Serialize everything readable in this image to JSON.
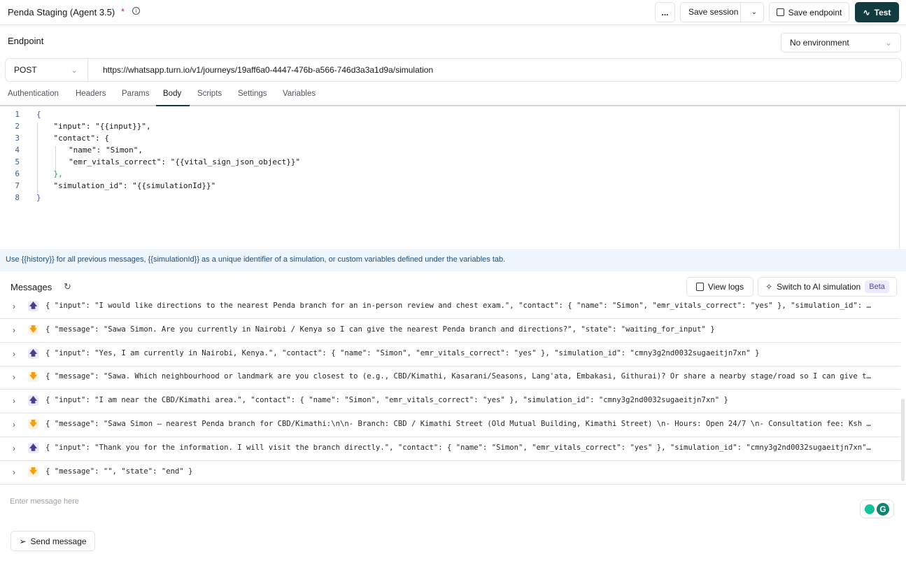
{
  "header": {
    "title": "Penda Staging (Agent 3.5)",
    "unsaved_marker": "*",
    "more_label": "...",
    "save_session": "Save session",
    "save_endpoint": "Save endpoint",
    "test": "Test"
  },
  "endpoint": {
    "label": "Endpoint",
    "environment": "No environment",
    "method": "POST",
    "url": "https://whatsapp.turn.io/v1/journeys/19aff6a0-4447-476b-a566-746d3a3a1d9a/simulation"
  },
  "tabs": [
    {
      "label": "Authentication"
    },
    {
      "label": "Headers"
    },
    {
      "label": "Params"
    },
    {
      "label": "Body",
      "active": true
    },
    {
      "label": "Scripts"
    },
    {
      "label": "Settings"
    },
    {
      "label": "Variables"
    }
  ],
  "body_code": [
    "{",
    "    \"input\": \"{{input}}\",",
    "    \"contact\": {",
    "        \"name\": \"Simon\",",
    "        \"emr_vitals_correct\": \"{{vital_sign_json_object}}\"",
    "    },",
    "    \"simulation_id\": \"{{simulationId}}\"",
    "}"
  ],
  "hint": "Use {{history}} for all previous messages, {{simulationId}} as a unique identifier of a simulation, or custom variables defined under the variables tab.",
  "messages": {
    "title": "Messages",
    "view_logs": "View logs",
    "switch_ai": "Switch to AI simulation",
    "beta": "Beta",
    "items": [
      {
        "direction": "up",
        "text": "{ \"input\": \"I would like directions to the nearest Penda branch for an in-person review and chest exam.\", \"contact\": { \"name\": \"Simon\", \"emr_vitals_correct\": \"yes\" }, \"simulation_id\": …"
      },
      {
        "direction": "down",
        "text": "{ \"message\": \"Sawa Simon. Are you currently in Nairobi / Kenya so I can give the nearest Penda branch and directions?\", \"state\": \"waiting_for_input\" }"
      },
      {
        "direction": "up",
        "text": "{ \"input\": \"Yes, I am currently in Nairobi, Kenya.\", \"contact\": { \"name\": \"Simon\", \"emr_vitals_correct\": \"yes\" }, \"simulation_id\": \"cmny3g2nd0032sugaeitjn7xn\" }"
      },
      {
        "direction": "down",
        "text": "{ \"message\": \"Sawa. Which neighbourhood or landmark are you closest to (e.g., CBD/Kimathi, Kasarani/Seasons, Lang'ata, Embakasi, Githurai)? Or share a nearby stage/road so I can give t…"
      },
      {
        "direction": "up",
        "text": "{ \"input\": \"I am near the CBD/Kimathi area.\", \"contact\": { \"name\": \"Simon\", \"emr_vitals_correct\": \"yes\" }, \"simulation_id\": \"cmny3g2nd0032sugaeitjn7xn\" }"
      },
      {
        "direction": "down",
        "text": "{ \"message\": \"Sawa Simon — nearest Penda branch for CBD/Kimathi:\\n\\n- Branch: CBD / Kimathi Street (Old Mutual Building, Kimathi Street) \\n- Hours: Open 24/7 \\n- Consultation fee: Ksh …"
      },
      {
        "direction": "up",
        "text": "{ \"input\": \"Thank you for the information. I will visit the branch directly.\", \"contact\": { \"name\": \"Simon\", \"emr_vitals_correct\": \"yes\" }, \"simulation_id\": \"cmny3g2nd0032sugaeitjn7xn\"…"
      },
      {
        "direction": "down",
        "text": "{ \"message\": \"\", \"state\": \"end\" }"
      }
    ]
  },
  "composer": {
    "placeholder": "Enter message here",
    "send": "Send message"
  },
  "colors": {
    "primary": "#123b3f",
    "accent_red": "#dc2626"
  }
}
